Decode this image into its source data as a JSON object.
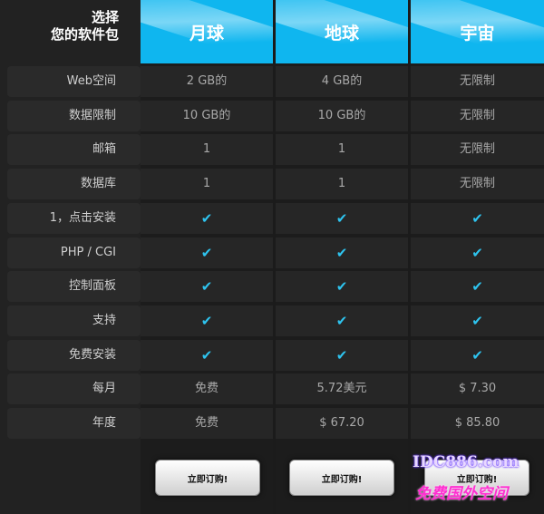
{
  "header": {
    "title_line1": "选择",
    "title_line2": "您的软件包"
  },
  "plans": [
    {
      "name": "月球"
    },
    {
      "name": "地球"
    },
    {
      "name": "宇宙"
    }
  ],
  "rows": [
    {
      "label": "Web空间",
      "values": [
        "2 GB的",
        "4 GB的",
        "无限制"
      ]
    },
    {
      "label": "数据限制",
      "values": [
        "10 GB的",
        "10 GB的",
        "无限制"
      ]
    },
    {
      "label": "邮箱",
      "values": [
        "1",
        "1",
        "无限制"
      ]
    },
    {
      "label": "数据库",
      "values": [
        "1",
        "1",
        "无限制"
      ]
    },
    {
      "label": "1，点击安装",
      "values": [
        "✔",
        "✔",
        "✔"
      ]
    },
    {
      "label": "PHP / CGI",
      "values": [
        "✔",
        "✔",
        "✔"
      ]
    },
    {
      "label": "控制面板",
      "values": [
        "✔",
        "✔",
        "✔"
      ]
    },
    {
      "label": "支持",
      "values": [
        "✔",
        "✔",
        "✔"
      ]
    },
    {
      "label": "免费安装",
      "values": [
        "✔",
        "✔",
        "✔"
      ]
    },
    {
      "label": "每月",
      "values": [
        "免费",
        "5.72美元",
        "$ 7.30"
      ]
    },
    {
      "label": "年度",
      "values": [
        "免费",
        "$ 67.20",
        "$ 85.80"
      ]
    }
  ],
  "buttons": {
    "order_label": "立即订购!"
  },
  "watermark": {
    "line1": "IDC886.com",
    "line2": "免费国外空间"
  },
  "colors": {
    "accent": "#0fb6ef",
    "check": "#2ec4ef",
    "background": "#1b1b1b"
  },
  "icons": {
    "check": "check-icon"
  }
}
